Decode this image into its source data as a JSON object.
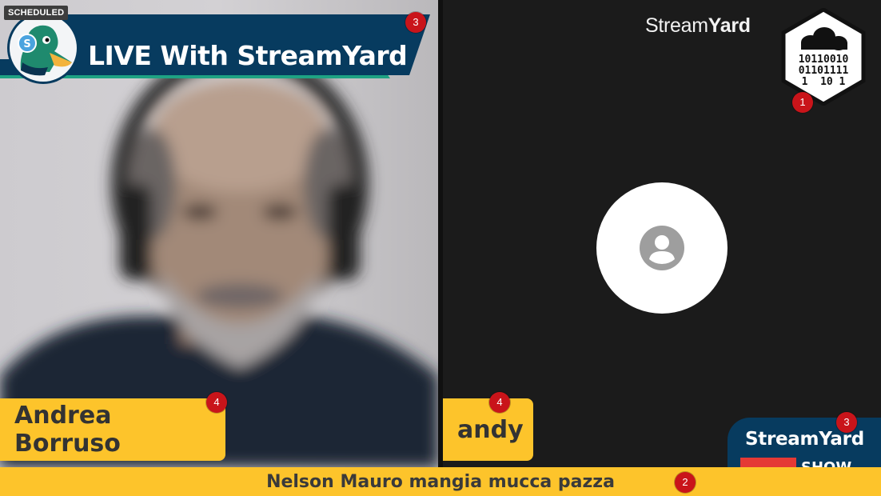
{
  "status_badge": "SCHEDULED",
  "banner": {
    "title": "LIVE With StreamYard"
  },
  "brand": {
    "wordmark_light": "Stream",
    "wordmark_bold": "Yard"
  },
  "hex_logo": {
    "line1": "10110010",
    "line2": "01101111",
    "line3": "1  10 1"
  },
  "participants": [
    {
      "name": "Andrea Borruso"
    },
    {
      "name": "andy"
    }
  ],
  "ticker": {
    "text": "Nelson Mauro mangia mucca pazza"
  },
  "show_badge": {
    "title": "StreamYard",
    "sub": "SHOW"
  },
  "markers": [
    "1",
    "2",
    "3",
    "3",
    "4",
    "4"
  ],
  "colors": {
    "accent_yellow": "#fdc42b",
    "banner_navy": "#073b5f",
    "banner_teal": "#1ea283",
    "marker_red": "#c9141a"
  }
}
